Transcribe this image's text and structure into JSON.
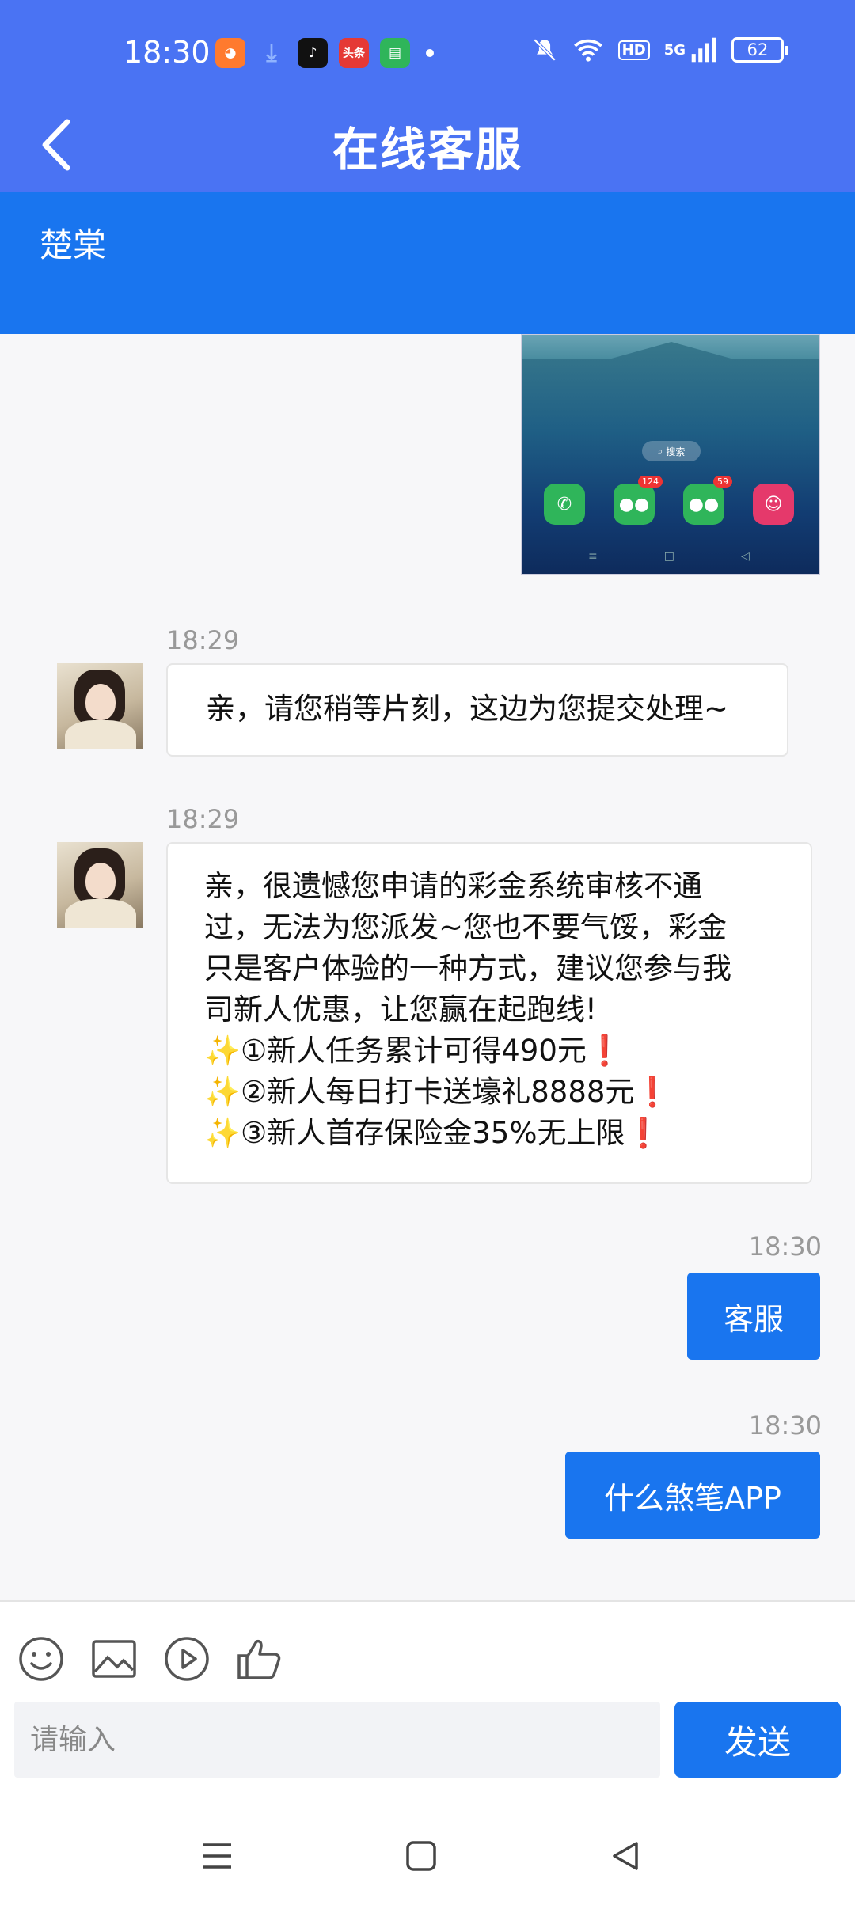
{
  "status_bar": {
    "time": "18:30",
    "apps": [
      {
        "icon": "app-icon-orange",
        "color": "#ff7a2e"
      },
      {
        "icon": "download-icon",
        "color": "#4a73f3"
      },
      {
        "icon": "tiktok-icon",
        "color": "#111111"
      },
      {
        "icon": "toutiao-icon",
        "label": "头条",
        "color": "#e53935"
      },
      {
        "icon": "messages-icon",
        "color": "#2fb55a"
      }
    ],
    "indicators": [
      "mute-icon",
      "wifi-icon",
      "HD",
      "5G",
      "signal-icon"
    ],
    "hd_label": "HD",
    "network_label": "5G",
    "battery": "62"
  },
  "header": {
    "title": "在线客服",
    "back_icon": "chevron-left-icon",
    "bg_color": "#4a73f3"
  },
  "agent": {
    "name": "楚棠",
    "bg_color": "#1975ef"
  },
  "shared_image": {
    "search_label": "搜索",
    "dock": [
      {
        "icon": "phone-icon",
        "color": "#2fb55a"
      },
      {
        "icon": "wechat-icon",
        "color": "#2fb55a",
        "badge": "124"
      },
      {
        "icon": "wechat-clone-icon",
        "color": "#2fb55a",
        "badge": "59"
      },
      {
        "icon": "game-app-icon",
        "color": "#e5396b"
      }
    ]
  },
  "messages": [
    {
      "side": "in",
      "time": "18:29",
      "text": "亲，请您稍等片刻，这边为您提交处理~"
    },
    {
      "side": "in",
      "time": "18:29",
      "lines": [
        "亲，很遗憾您申请的彩金系统审核不通",
        "过，无法为您派发~您也不要气馁，彩金",
        "只是客户体验的一种方式，建议您参与我",
        "司新人优惠，让您赢在起跑线!"
      ],
      "bullets": [
        "①新人任务累计可得490元",
        "②新人每日打卡送壕礼8888元",
        "③新人首存保险金35%无上限"
      ]
    },
    {
      "side": "out",
      "time": "18:30",
      "text": "客服"
    },
    {
      "side": "out",
      "time": "18:30",
      "text": "什么煞笔APP"
    }
  ],
  "composer": {
    "placeholder": "请输入",
    "send_label": "发送",
    "tools": [
      "emoji-icon",
      "image-icon",
      "video-icon",
      "thumbs-up-icon"
    ]
  },
  "nav": [
    "menu-icon",
    "home-icon",
    "back-icon"
  ]
}
